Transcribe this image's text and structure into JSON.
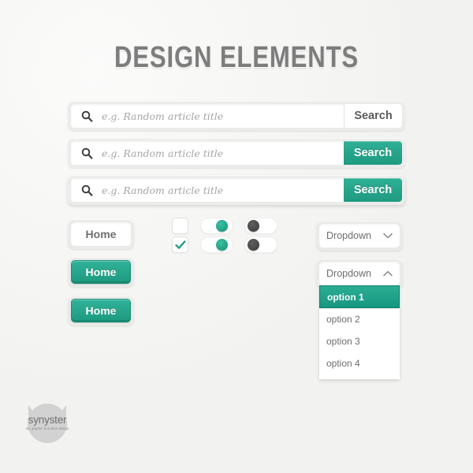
{
  "page": {
    "title": "DESIGN ELEMENTS",
    "background_color": "#f4f4f2",
    "accent_color": "#1e9a80",
    "muted_text_color": "#6e6e6e"
  },
  "search_bars": [
    {
      "icon": "search-icon",
      "placeholder": "e.g. Random article title",
      "value": "",
      "button_label": "Search",
      "button_style": "plain"
    },
    {
      "icon": "search-icon",
      "placeholder": "e.g. Random article title",
      "value": "",
      "button_label": "Search",
      "button_style": "teal"
    },
    {
      "icon": "search-icon",
      "placeholder": "e.g. Random article title",
      "value": "",
      "button_label": "Search",
      "button_style": "teal"
    }
  ],
  "buttons": [
    {
      "label": "Home",
      "style": "white"
    },
    {
      "label": "Home",
      "style": "teal"
    },
    {
      "label": "Home",
      "style": "teal"
    }
  ],
  "checkboxes": [
    {
      "checked": false,
      "glyph": ""
    },
    {
      "checked": true,
      "glyph": "checkmark-icon"
    }
  ],
  "toggles": [
    {
      "state": "on",
      "knob_color": "#1e9a80"
    },
    {
      "state": "on",
      "knob_color": "#4a4a4a"
    },
    {
      "state": "on",
      "knob_color": "#1e9a80"
    },
    {
      "state": "on",
      "knob_color": "#4a4a4a"
    }
  ],
  "dropdown_closed": {
    "label": "Dropdown",
    "icon": "chevron-down-icon",
    "expanded": false
  },
  "dropdown_open": {
    "label": "Dropdown",
    "icon": "chevron-up-icon",
    "expanded": true,
    "options": [
      {
        "label": "option 1",
        "selected": true
      },
      {
        "label": "option 2",
        "selected": false
      },
      {
        "label": "option 3",
        "selected": false
      },
      {
        "label": "option 4",
        "selected": false
      }
    ]
  },
  "logo": {
    "name": "synyster",
    "tagline": "3d, graphic & motion design"
  }
}
